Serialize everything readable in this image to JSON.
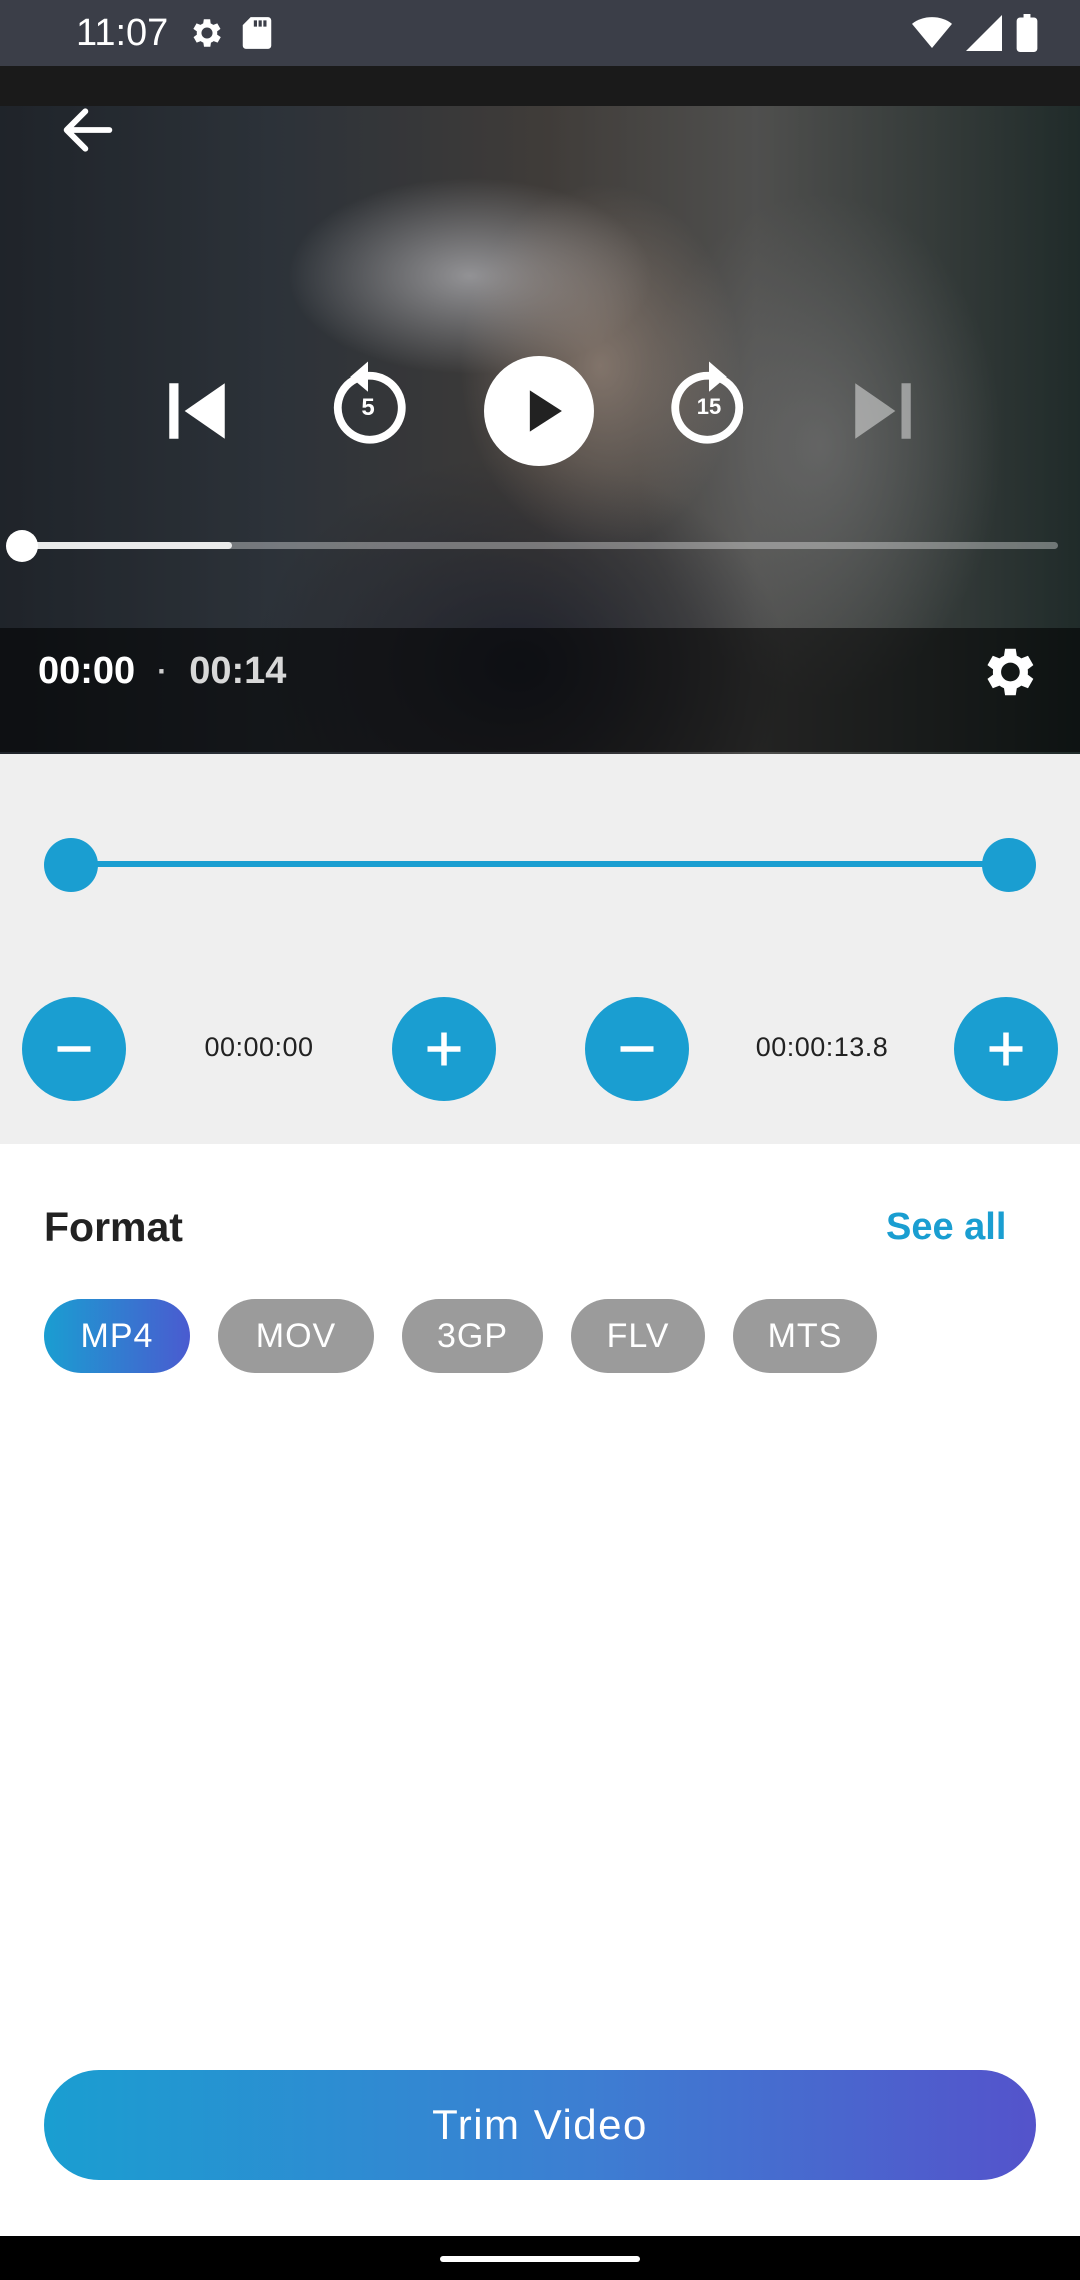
{
  "status_bar": {
    "time": "11:07",
    "left_icons": [
      "gear-icon",
      "sd-card-icon"
    ],
    "right_icons": [
      "wifi-icon",
      "signal-icon",
      "battery-icon"
    ]
  },
  "player": {
    "current_time": "00:00",
    "separator": "·",
    "total_time": "00:14",
    "rewind_seconds": "5",
    "forward_seconds": "15",
    "buffered_fraction": 0.2,
    "progress_fraction": 0.0
  },
  "trim": {
    "start_time": "00:00:00",
    "end_time": "00:00:13.8",
    "range_start_fraction": 0.0,
    "range_end_fraction": 1.0
  },
  "format": {
    "title": "Format",
    "see_all": "See all",
    "options": [
      "MP4",
      "MOV",
      "3GP",
      "FLV",
      "MTS"
    ],
    "selected": "MP4"
  },
  "action": {
    "trim_label": "Trim Video"
  },
  "colors": {
    "accent": "#1a9ed1",
    "gradient_end": "#5453cb",
    "chip_inactive": "#9b9b9b",
    "trim_background": "#efefef"
  }
}
